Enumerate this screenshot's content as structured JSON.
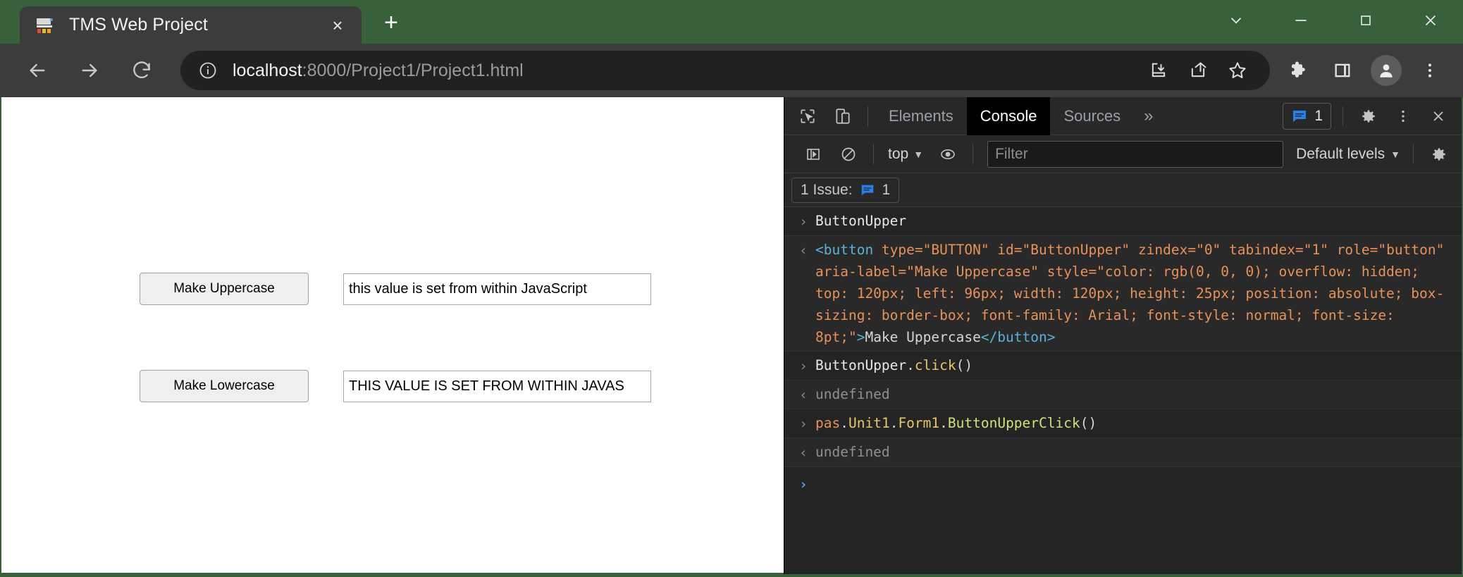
{
  "window": {
    "chrome_color": "#36613b",
    "controls": {
      "collapse": "chevron-down",
      "minimize": "minimize",
      "maximize": "maximize",
      "close": "close"
    }
  },
  "tab": {
    "title": "TMS Web Project",
    "close_label": "×",
    "newtab_label": "+"
  },
  "toolbar": {
    "back": "←",
    "forward": "→",
    "reload": "⟳",
    "url_host": "localhost",
    "url_rest": ":8000/Project1/Project1.html",
    "url_full": "localhost:8000/Project1/Project1.html",
    "icons": {
      "info": "info-icon",
      "install": "install-icon",
      "share": "share-icon",
      "bookmark": "star-icon",
      "extensions": "puzzle-icon",
      "sidepanel": "side-panel-icon",
      "profile": "profile-avatar-icon",
      "menu": "three-dot-menu-icon"
    }
  },
  "page": {
    "button_upper": "Make Uppercase",
    "button_lower": "Make Lowercase",
    "edit_upper_value": "this value is set from within JavaScript",
    "edit_lower_value": "THIS VALUE IS SET FROM WITHIN JAVAS"
  },
  "devtools": {
    "tabs": [
      {
        "label": "Elements",
        "active": false
      },
      {
        "label": "Console",
        "active": true
      },
      {
        "label": "Sources",
        "active": false
      }
    ],
    "more_label": "»",
    "issues_count": "1",
    "settings_label": "gear-icon",
    "close_label": "×",
    "filterbar": {
      "context": "top",
      "filter_placeholder": "Filter",
      "levels": "Default levels"
    },
    "issues_bar": {
      "text": "1 Issue:",
      "count": "1"
    },
    "console_rows": [
      {
        "kind": "input",
        "gutter": "›",
        "tokens": [
          {
            "t": "ButtonUpper",
            "c": "tk-id"
          }
        ]
      },
      {
        "kind": "output",
        "gutter": "‹",
        "tokens": [
          {
            "t": "<button",
            "c": "tk-tag"
          },
          {
            "t": " type=",
            "c": "tk-attr"
          },
          {
            "t": "\"BUTTON\"",
            "c": "tk-val"
          },
          {
            "t": " id=",
            "c": "tk-attr"
          },
          {
            "t": "\"ButtonUpper\"",
            "c": "tk-val"
          },
          {
            "t": " zindex=",
            "c": "tk-attr"
          },
          {
            "t": "\"0\"",
            "c": "tk-val"
          },
          {
            "t": " tabindex=",
            "c": "tk-attr"
          },
          {
            "t": "\"1\"",
            "c": "tk-val"
          },
          {
            "t": " role=",
            "c": "tk-attr"
          },
          {
            "t": "\"button\"",
            "c": "tk-val"
          },
          {
            "t": " aria-label=",
            "c": "tk-attr"
          },
          {
            "t": "\"Make Uppercase\"",
            "c": "tk-val"
          },
          {
            "t": " style=",
            "c": "tk-attr"
          },
          {
            "t": "\"color: rgb(0, 0, 0); overflow: hidden; top: 120px; left: 96px; width: 120px; height: 25px; position: absolute; box-sizing: border-box; font-family: Arial; font-style: normal; font-size: 8pt;\"",
            "c": "tk-val"
          },
          {
            "t": ">",
            "c": "tk-tag"
          },
          {
            "t": "Make Uppercase",
            "c": "tk-text"
          },
          {
            "t": "</button>",
            "c": "tk-tag"
          }
        ]
      },
      {
        "kind": "input",
        "gutter": "›",
        "tokens": [
          {
            "t": "ButtonUpper",
            "c": "tk-id"
          },
          {
            "t": ".",
            "c": "tk-plain"
          },
          {
            "t": "click",
            "c": "tk-fn"
          },
          {
            "t": "()",
            "c": "tk-plain"
          }
        ]
      },
      {
        "kind": "output",
        "gutter": "‹",
        "tokens": [
          {
            "t": "undefined",
            "c": "tk-dim"
          }
        ]
      },
      {
        "kind": "input",
        "gutter": "›",
        "tokens": [
          {
            "t": "pas",
            "c": "tk-obj"
          },
          {
            "t": ".",
            "c": "tk-plain"
          },
          {
            "t": "Unit1",
            "c": "tk-fn"
          },
          {
            "t": ".",
            "c": "tk-plain"
          },
          {
            "t": "Form1",
            "c": "tk-fn"
          },
          {
            "t": ".",
            "c": "tk-plain"
          },
          {
            "t": "ButtonUpperClick",
            "c": "tk-prop"
          },
          {
            "t": "()",
            "c": "tk-plain"
          }
        ]
      },
      {
        "kind": "output",
        "gutter": "‹",
        "tokens": [
          {
            "t": "undefined",
            "c": "tk-dim"
          }
        ]
      }
    ],
    "prompt_symbol": "›"
  }
}
